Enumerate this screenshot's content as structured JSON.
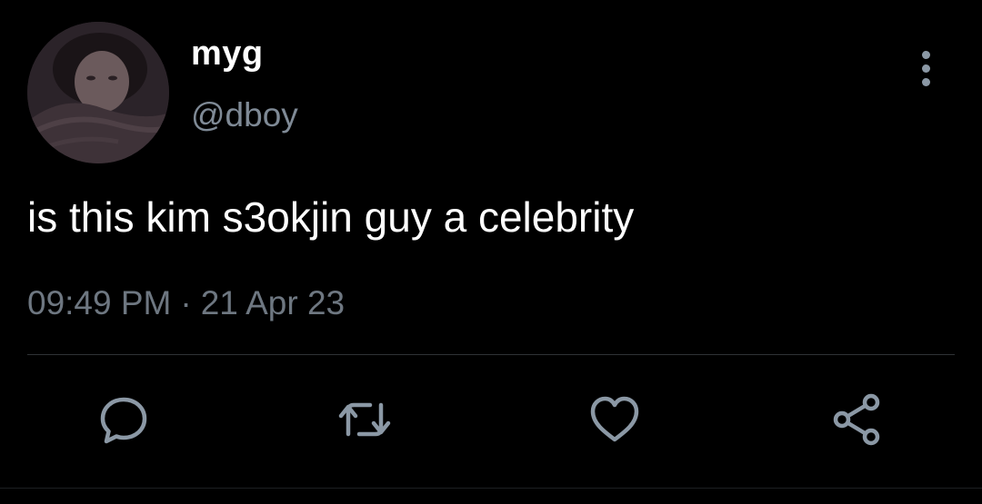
{
  "user": {
    "display_name": "myg",
    "handle": "@dboy"
  },
  "tweet": {
    "text": "is this kim s3okjin guy a celebrity",
    "time": "09:49 PM",
    "separator": "·",
    "date": "21 Apr 23"
  },
  "icons": {
    "more": "more-vertical-icon",
    "reply": "reply-icon",
    "retweet": "retweet-icon",
    "like": "heart-icon",
    "share": "share-icon"
  },
  "colors": {
    "background": "#000000",
    "name": "#ffffff",
    "secondary": "#7f8a96",
    "icon": "#8b98a5",
    "divider": "#2f3336"
  }
}
